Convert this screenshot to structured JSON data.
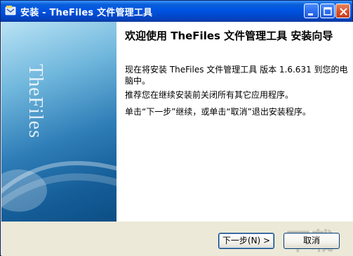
{
  "window": {
    "title": "安装 - TheFiles 文件管理工具",
    "icon": "installer-icon",
    "controls": [
      "minimize-icon",
      "maximize-icon",
      "close-icon"
    ]
  },
  "sidebar": {
    "brand_text": "TheFiles"
  },
  "content": {
    "heading": "欢迎使用 TheFiles 文件管理工具 安装向导",
    "para1": "现在将安装 TheFiles 文件管理工具 版本 1.6.631 到您的电脑中。",
    "para2": "推荐您在继续安装前关闭所有其它应用程序。",
    "para3": "单击“下一步”继续，或单击“取消”退出安装程序。"
  },
  "buttons": {
    "next_label": "下一步(N) >",
    "cancel_label": "取消"
  },
  "colors": {
    "titlebar": "#0054e3",
    "sidepanel_dark": "#165f9a",
    "sidepanel_light": "#b9e3f5",
    "face": "#ece9d8"
  }
}
